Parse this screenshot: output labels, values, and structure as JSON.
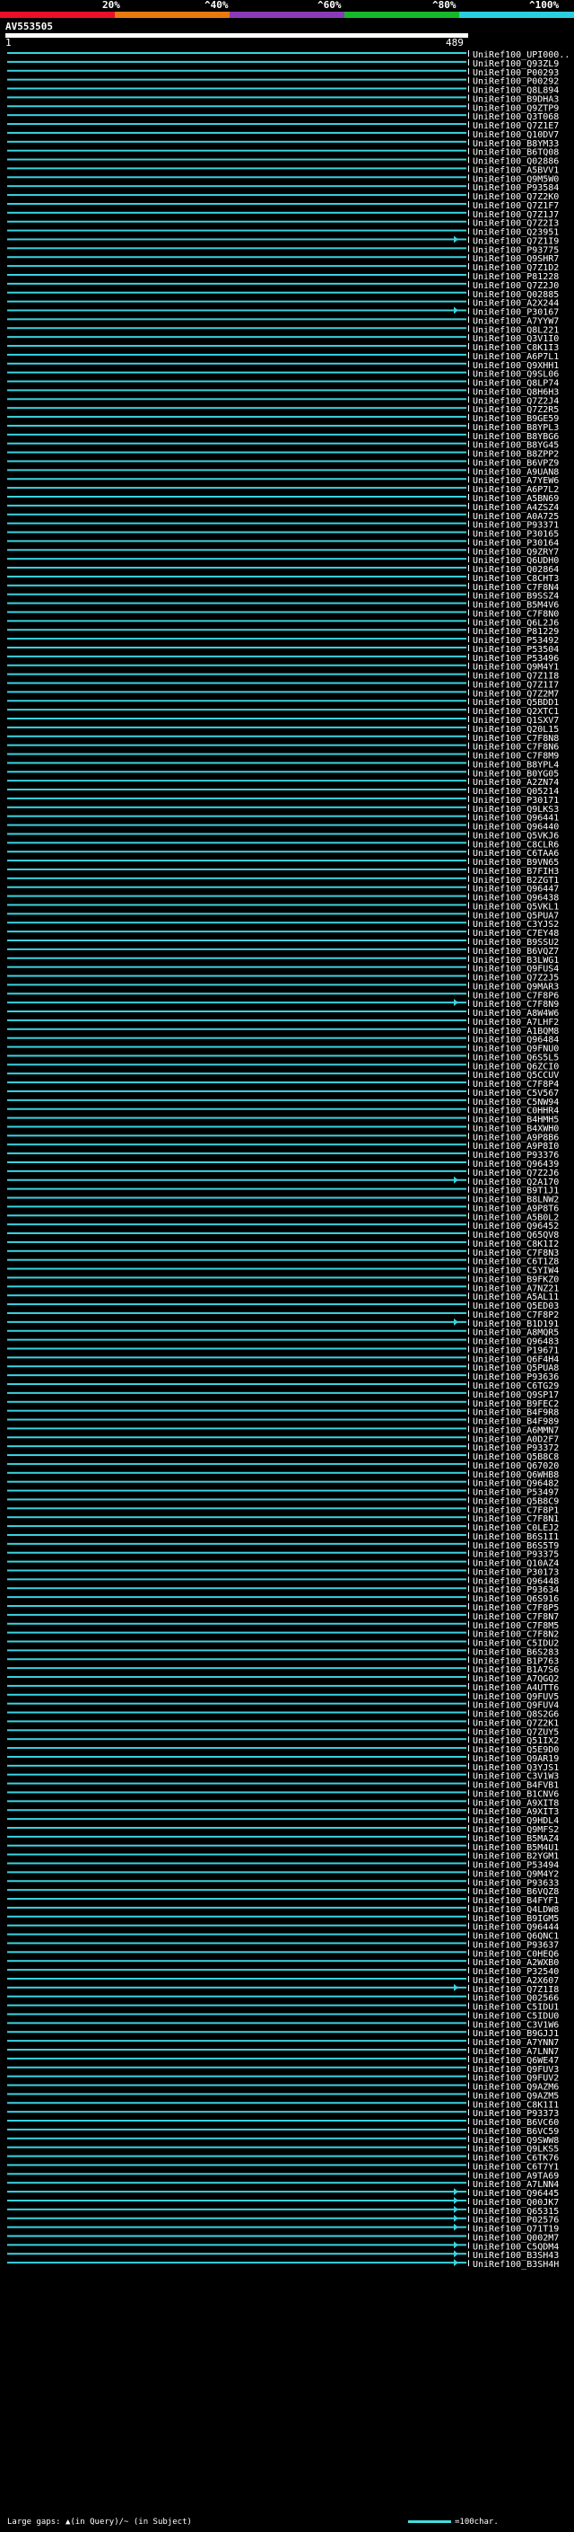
{
  "legend": {
    "labels": [
      "20%",
      "^40%",
      "^60%",
      "^80%",
      "^100%"
    ],
    "colors": [
      "#e8102a",
      "#e87a10",
      "#8a3ab8",
      "#16b82a",
      "#2ad0e0"
    ]
  },
  "query": {
    "title": "AV553505",
    "start": "1",
    "end": "489"
  },
  "footer": {
    "text": "Large gaps: ▲(in Query)/~ (in Subject)",
    "scale": "=100char."
  },
  "colors": {
    "hit": "#3ad4e0",
    "background": "#000000",
    "text": "#ffffff"
  },
  "chart_data": {
    "type": "alignment-overview",
    "query_length": 489,
    "hits": [
      {
        "id": "UniRef100_UPI000..",
        "gap_end": false
      },
      {
        "id": "UniRef100_Q93ZL9",
        "gap_end": false
      },
      {
        "id": "UniRef100_P00293",
        "gap_end": false
      },
      {
        "id": "UniRef100_P00292",
        "gap_end": false
      },
      {
        "id": "UniRef100_Q8L894",
        "gap_end": false
      },
      {
        "id": "UniRef100_B9DHA3",
        "gap_end": false
      },
      {
        "id": "UniRef100_Q9ZTP9",
        "gap_end": false
      },
      {
        "id": "UniRef100_Q3T068",
        "gap_end": false
      },
      {
        "id": "UniRef100_Q7Z1E7",
        "gap_end": false
      },
      {
        "id": "UniRef100_Q10DV7",
        "gap_end": false
      },
      {
        "id": "UniRef100_B8YM33",
        "gap_end": false
      },
      {
        "id": "UniRef100_B6TQ08",
        "gap_end": false
      },
      {
        "id": "UniRef100_Q02886",
        "gap_end": false
      },
      {
        "id": "UniRef100_A5BVV1",
        "gap_end": false
      },
      {
        "id": "UniRef100_Q9M5W0",
        "gap_end": false
      },
      {
        "id": "UniRef100_P93584",
        "gap_end": false
      },
      {
        "id": "UniRef100_Q7Z2K0",
        "gap_end": false
      },
      {
        "id": "UniRef100_Q7Z1F7",
        "gap_end": false
      },
      {
        "id": "UniRef100_Q7Z1J7",
        "gap_end": false
      },
      {
        "id": "UniRef100_Q7Z2I3",
        "gap_end": false
      },
      {
        "id": "UniRef100_Q23951",
        "gap_end": false
      },
      {
        "id": "UniRef100_Q7Z1I9",
        "gap_end": true
      },
      {
        "id": "UniRef100_P93775",
        "gap_end": false
      },
      {
        "id": "UniRef100_Q9SHR7",
        "gap_end": false
      },
      {
        "id": "UniRef100_Q7Z1D2",
        "gap_end": false
      },
      {
        "id": "UniRef100_P81228",
        "gap_end": false
      },
      {
        "id": "UniRef100_Q7Z2J0",
        "gap_end": false
      },
      {
        "id": "UniRef100_Q02885",
        "gap_end": false
      },
      {
        "id": "UniRef100_A2X244",
        "gap_end": false
      },
      {
        "id": "UniRef100_P30167",
        "gap_end": true
      },
      {
        "id": "UniRef100_A7YYW7",
        "gap_end": false
      },
      {
        "id": "UniRef100_Q8L221",
        "gap_end": false
      },
      {
        "id": "UniRef100_Q3V1I0",
        "gap_end": false
      },
      {
        "id": "UniRef100_C8K1I3",
        "gap_end": false
      },
      {
        "id": "UniRef100_A6P7L1",
        "gap_end": false
      },
      {
        "id": "UniRef100_Q9XHH1",
        "gap_end": false
      },
      {
        "id": "UniRef100_Q9SL06",
        "gap_end": false
      },
      {
        "id": "UniRef100_Q8LP74",
        "gap_end": false
      },
      {
        "id": "UniRef100_Q8H6H3",
        "gap_end": false
      },
      {
        "id": "UniRef100_Q7Z2J4",
        "gap_end": false
      },
      {
        "id": "UniRef100_Q7Z2R5",
        "gap_end": false
      },
      {
        "id": "UniRef100_B9GE59",
        "gap_end": false
      },
      {
        "id": "UniRef100_B8YPL3",
        "gap_end": false
      },
      {
        "id": "UniRef100_B8YBG6",
        "gap_end": false
      },
      {
        "id": "UniRef100_B8YG45",
        "gap_end": false
      },
      {
        "id": "UniRef100_B8ZPP2",
        "gap_end": false
      },
      {
        "id": "UniRef100_B6VPZ9",
        "gap_end": false
      },
      {
        "id": "UniRef100_A9UAN8",
        "gap_end": false
      },
      {
        "id": "UniRef100_A7YEW6",
        "gap_end": false
      },
      {
        "id": "UniRef100_A6P7L2",
        "gap_end": false
      },
      {
        "id": "UniRef100_A5BN69",
        "gap_end": false
      },
      {
        "id": "UniRef100_A4ZSZ4",
        "gap_end": false
      },
      {
        "id": "UniRef100_A0A725",
        "gap_end": false
      },
      {
        "id": "UniRef100_P93371",
        "gap_end": false
      },
      {
        "id": "UniRef100_P30165",
        "gap_end": false
      },
      {
        "id": "UniRef100_P30164",
        "gap_end": false
      },
      {
        "id": "UniRef100_Q9ZRY7",
        "gap_end": false
      },
      {
        "id": "UniRef100_Q6UDH0",
        "gap_end": false
      },
      {
        "id": "UniRef100_Q02864",
        "gap_end": false
      },
      {
        "id": "UniRef100_C8CHT3",
        "gap_end": false
      },
      {
        "id": "UniRef100_C7F8N4",
        "gap_end": false
      },
      {
        "id": "UniRef100_B9SSZ4",
        "gap_end": false
      },
      {
        "id": "UniRef100_B5M4V6",
        "gap_end": false
      },
      {
        "id": "UniRef100_C7F8N0",
        "gap_end": false
      },
      {
        "id": "UniRef100_Q6L2J6",
        "gap_end": false
      },
      {
        "id": "UniRef100_P81229",
        "gap_end": false
      },
      {
        "id": "UniRef100_P53492",
        "gap_end": false
      },
      {
        "id": "UniRef100_P53504",
        "gap_end": false
      },
      {
        "id": "UniRef100_P53496",
        "gap_end": false
      },
      {
        "id": "UniRef100_Q9M4Y1",
        "gap_end": false
      },
      {
        "id": "UniRef100_Q7Z1I8",
        "gap_end": false
      },
      {
        "id": "UniRef100_Q7Z1I7",
        "gap_end": false
      },
      {
        "id": "UniRef100_Q7Z2M7",
        "gap_end": false
      },
      {
        "id": "UniRef100_Q5BDD1",
        "gap_end": false
      },
      {
        "id": "UniRef100_Q2XTC1",
        "gap_end": false
      },
      {
        "id": "UniRef100_Q1SXV7",
        "gap_end": false
      },
      {
        "id": "UniRef100_Q20L15",
        "gap_end": false
      },
      {
        "id": "UniRef100_C7F8N8",
        "gap_end": false
      },
      {
        "id": "UniRef100_C7F8N6",
        "gap_end": false
      },
      {
        "id": "UniRef100_C7F8M9",
        "gap_end": false
      },
      {
        "id": "UniRef100_B8YPL4",
        "gap_end": false
      },
      {
        "id": "UniRef100_B0YG05",
        "gap_end": false
      },
      {
        "id": "UniRef100_A2ZN74",
        "gap_end": false
      },
      {
        "id": "UniRef100_Q05214",
        "gap_end": false
      },
      {
        "id": "UniRef100_P30171",
        "gap_end": false
      },
      {
        "id": "UniRef100_Q9LKS3",
        "gap_end": false
      },
      {
        "id": "UniRef100_Q96441",
        "gap_end": false
      },
      {
        "id": "UniRef100_Q96440",
        "gap_end": false
      },
      {
        "id": "UniRef100_Q5VKJ6",
        "gap_end": false
      },
      {
        "id": "UniRef100_C8CLR6",
        "gap_end": false
      },
      {
        "id": "UniRef100_C6TAA6",
        "gap_end": false
      },
      {
        "id": "UniRef100_B9VN65",
        "gap_end": false
      },
      {
        "id": "UniRef100_B7FIH3",
        "gap_end": false
      },
      {
        "id": "UniRef100_B2ZGT1",
        "gap_end": false
      },
      {
        "id": "UniRef100_Q96447",
        "gap_end": false
      },
      {
        "id": "UniRef100_Q96438",
        "gap_end": false
      },
      {
        "id": "UniRef100_Q5VKL1",
        "gap_end": false
      },
      {
        "id": "UniRef100_Q5PUA7",
        "gap_end": false
      },
      {
        "id": "UniRef100_C3YJS2",
        "gap_end": false
      },
      {
        "id": "UniRef100_C7EY48",
        "gap_end": false
      },
      {
        "id": "UniRef100_B9SSU2",
        "gap_end": false
      },
      {
        "id": "UniRef100_B6VQZ7",
        "gap_end": false
      },
      {
        "id": "UniRef100_B3LWG1",
        "gap_end": false
      },
      {
        "id": "UniRef100_Q9FUS4",
        "gap_end": false
      },
      {
        "id": "UniRef100_Q7Z2J5",
        "gap_end": false
      },
      {
        "id": "UniRef100_Q9MAR3",
        "gap_end": false
      },
      {
        "id": "UniRef100_C7F8P6",
        "gap_end": false
      },
      {
        "id": "UniRef100_C7F8N9",
        "gap_end": true
      },
      {
        "id": "UniRef100_A8W4W6",
        "gap_end": false
      },
      {
        "id": "UniRef100_A7LHF2",
        "gap_end": false
      },
      {
        "id": "UniRef100_A1BQM8",
        "gap_end": false
      },
      {
        "id": "UniRef100_Q96484",
        "gap_end": false
      },
      {
        "id": "UniRef100_Q9FNU0",
        "gap_end": false
      },
      {
        "id": "UniRef100_Q6S5L5",
        "gap_end": false
      },
      {
        "id": "UniRef100_Q6ZCI0",
        "gap_end": false
      },
      {
        "id": "UniRef100_Q5CCUV",
        "gap_end": false
      },
      {
        "id": "UniRef100_C7F8P4",
        "gap_end": false
      },
      {
        "id": "UniRef100_C5V567",
        "gap_end": false
      },
      {
        "id": "UniRef100_C5NW94",
        "gap_end": false
      },
      {
        "id": "UniRef100_C0HHR4",
        "gap_end": false
      },
      {
        "id": "UniRef100_B4HMH5",
        "gap_end": false
      },
      {
        "id": "UniRef100_B4XWH0",
        "gap_end": false
      },
      {
        "id": "UniRef100_A9P8B6",
        "gap_end": false
      },
      {
        "id": "UniRef100_A9P8I0",
        "gap_end": false
      },
      {
        "id": "UniRef100_P93376",
        "gap_end": false
      },
      {
        "id": "UniRef100_Q96439",
        "gap_end": false
      },
      {
        "id": "UniRef100_Q7Z2J6",
        "gap_end": false
      },
      {
        "id": "UniRef100_Q2A170",
        "gap_end": true
      },
      {
        "id": "UniRef100_B9T1J1",
        "gap_end": false
      },
      {
        "id": "UniRef100_B8LNW2",
        "gap_end": false
      },
      {
        "id": "UniRef100_A9P8T6",
        "gap_end": false
      },
      {
        "id": "UniRef100_A5B0L2",
        "gap_end": false
      },
      {
        "id": "UniRef100_Q96452",
        "gap_end": false
      },
      {
        "id": "UniRef100_Q65QV8",
        "gap_end": false
      },
      {
        "id": "UniRef100_C8K1I2",
        "gap_end": false
      },
      {
        "id": "UniRef100_C7F8N3",
        "gap_end": false
      },
      {
        "id": "UniRef100_C6T1Z8",
        "gap_end": false
      },
      {
        "id": "UniRef100_C5YIW4",
        "gap_end": false
      },
      {
        "id": "UniRef100_B9FKZ0",
        "gap_end": false
      },
      {
        "id": "UniRef100_A7NZ21",
        "gap_end": false
      },
      {
        "id": "UniRef100_A5AL11",
        "gap_end": false
      },
      {
        "id": "UniRef100_Q5ED03",
        "gap_end": false
      },
      {
        "id": "UniRef100_C7F8P2",
        "gap_end": false
      },
      {
        "id": "UniRef100_B1D191",
        "gap_end": true
      },
      {
        "id": "UniRef100_A8MQR5",
        "gap_end": false
      },
      {
        "id": "UniRef100_Q96483",
        "gap_end": false
      },
      {
        "id": "UniRef100_P19671",
        "gap_end": false
      },
      {
        "id": "UniRef100_Q6F4H4",
        "gap_end": false
      },
      {
        "id": "UniRef100_Q5PUA8",
        "gap_end": false
      },
      {
        "id": "UniRef100_P93636",
        "gap_end": false
      },
      {
        "id": "UniRef100_C6TG29",
        "gap_end": false
      },
      {
        "id": "UniRef100_Q9SP17",
        "gap_end": false
      },
      {
        "id": "UniRef100_B9FEC2",
        "gap_end": false
      },
      {
        "id": "UniRef100_B4F9R8",
        "gap_end": false
      },
      {
        "id": "UniRef100_B4F989",
        "gap_end": false
      },
      {
        "id": "UniRef100_A6MMN7",
        "gap_end": false
      },
      {
        "id": "UniRef100_A0D2F7",
        "gap_end": false
      },
      {
        "id": "UniRef100_P93372",
        "gap_end": false
      },
      {
        "id": "UniRef100_Q5B8C8",
        "gap_end": false
      },
      {
        "id": "UniRef100_Q67020",
        "gap_end": false
      },
      {
        "id": "UniRef100_Q6WHB8",
        "gap_end": false
      },
      {
        "id": "UniRef100_Q96482",
        "gap_end": false
      },
      {
        "id": "UniRef100_P53497",
        "gap_end": false
      },
      {
        "id": "UniRef100_Q5B8C9",
        "gap_end": false
      },
      {
        "id": "UniRef100_C7F8P1",
        "gap_end": false
      },
      {
        "id": "UniRef100_C7F8N1",
        "gap_end": false
      },
      {
        "id": "UniRef100_C0LEJ2",
        "gap_end": false
      },
      {
        "id": "UniRef100_B6S1I1",
        "gap_end": false
      },
      {
        "id": "UniRef100_B6S5T9",
        "gap_end": false
      },
      {
        "id": "UniRef100_P93375",
        "gap_end": false
      },
      {
        "id": "UniRef100_Q10AZ4",
        "gap_end": false
      },
      {
        "id": "UniRef100_P30173",
        "gap_end": false
      },
      {
        "id": "UniRef100_Q96448",
        "gap_end": false
      },
      {
        "id": "UniRef100_P93634",
        "gap_end": false
      },
      {
        "id": "UniRef100_Q6S916",
        "gap_end": false
      },
      {
        "id": "UniRef100_C7F8P5",
        "gap_end": false
      },
      {
        "id": "UniRef100_C7F8N7",
        "gap_end": false
      },
      {
        "id": "UniRef100_C7F8M5",
        "gap_end": false
      },
      {
        "id": "UniRef100_C7F8N2",
        "gap_end": false
      },
      {
        "id": "UniRef100_C5IDU2",
        "gap_end": false
      },
      {
        "id": "UniRef100_B6S283",
        "gap_end": false
      },
      {
        "id": "UniRef100_B1P763",
        "gap_end": false
      },
      {
        "id": "UniRef100_B1A7S6",
        "gap_end": false
      },
      {
        "id": "UniRef100_A7QGQ2",
        "gap_end": false
      },
      {
        "id": "UniRef100_A4UTT6",
        "gap_end": false
      },
      {
        "id": "UniRef100_Q9FUV5",
        "gap_end": false
      },
      {
        "id": "UniRef100_Q9FUV4",
        "gap_end": false
      },
      {
        "id": "UniRef100_Q8S2G6",
        "gap_end": false
      },
      {
        "id": "UniRef100_Q7Z2K1",
        "gap_end": false
      },
      {
        "id": "UniRef100_Q7ZUY5",
        "gap_end": false
      },
      {
        "id": "UniRef100_Q51IX2",
        "gap_end": false
      },
      {
        "id": "UniRef100_Q5E9D0",
        "gap_end": false
      },
      {
        "id": "UniRef100_Q9AR19",
        "gap_end": false
      },
      {
        "id": "UniRef100_Q3YJS1",
        "gap_end": false
      },
      {
        "id": "UniRef100_C3V1W3",
        "gap_end": false
      },
      {
        "id": "UniRef100_B4FVB1",
        "gap_end": false
      },
      {
        "id": "UniRef100_B1CNV6",
        "gap_end": false
      },
      {
        "id": "UniRef100_A9XIT8",
        "gap_end": false
      },
      {
        "id": "UniRef100_A9XIT3",
        "gap_end": false
      },
      {
        "id": "UniRef100_Q9HDL4",
        "gap_end": false
      },
      {
        "id": "UniRef100_Q9MFS2",
        "gap_end": false
      },
      {
        "id": "UniRef100_B5MAZ4",
        "gap_end": false
      },
      {
        "id": "UniRef100_B5M4U1",
        "gap_end": false
      },
      {
        "id": "UniRef100_B2YGM1",
        "gap_end": false
      },
      {
        "id": "UniRef100_P53494",
        "gap_end": false
      },
      {
        "id": "UniRef100_Q9M4Y2",
        "gap_end": false
      },
      {
        "id": "UniRef100_P93633",
        "gap_end": false
      },
      {
        "id": "UniRef100_B6VQZ8",
        "gap_end": false
      },
      {
        "id": "UniRef100_B4FYF1",
        "gap_end": false
      },
      {
        "id": "UniRef100_Q4LDW8",
        "gap_end": false
      },
      {
        "id": "UniRef100_B9IGM5",
        "gap_end": false
      },
      {
        "id": "UniRef100_Q96444",
        "gap_end": false
      },
      {
        "id": "UniRef100_Q6QNC1",
        "gap_end": false
      },
      {
        "id": "UniRef100_P93637",
        "gap_end": false
      },
      {
        "id": "UniRef100_C0HEQ6",
        "gap_end": false
      },
      {
        "id": "UniRef100_A2WXB0",
        "gap_end": false
      },
      {
        "id": "UniRef100_P32540",
        "gap_end": false
      },
      {
        "id": "UniRef100_A2X607",
        "gap_end": false
      },
      {
        "id": "UniRef100_Q7Z1I8",
        "gap_end": true
      },
      {
        "id": "UniRef100_Q02566",
        "gap_end": false
      },
      {
        "id": "UniRef100_C5IDU1",
        "gap_end": false
      },
      {
        "id": "UniRef100_C5IDU0",
        "gap_end": false
      },
      {
        "id": "UniRef100_C3V1W6",
        "gap_end": false
      },
      {
        "id": "UniRef100_B9GJJ1",
        "gap_end": false
      },
      {
        "id": "UniRef100_A7YNN7",
        "gap_end": false
      },
      {
        "id": "UniRef100_A7LNN7",
        "gap_end": false
      },
      {
        "id": "UniRef100_Q6WE47",
        "gap_end": false
      },
      {
        "id": "UniRef100_Q9FUV3",
        "gap_end": false
      },
      {
        "id": "UniRef100_Q9FUV2",
        "gap_end": false
      },
      {
        "id": "UniRef100_Q9AZM6",
        "gap_end": false
      },
      {
        "id": "UniRef100_Q9AZM5",
        "gap_end": false
      },
      {
        "id": "UniRef100_C8K1I1",
        "gap_end": false
      },
      {
        "id": "UniRef100_P93373",
        "gap_end": false
      },
      {
        "id": "UniRef100_B6VC60",
        "gap_end": false
      },
      {
        "id": "UniRef100_B6VC59",
        "gap_end": false
      },
      {
        "id": "UniRef100_Q9SWW8",
        "gap_end": false
      },
      {
        "id": "UniRef100_Q9LKS5",
        "gap_end": false
      },
      {
        "id": "UniRef100_C6TK76",
        "gap_end": false
      },
      {
        "id": "UniRef100_C6T7Y1",
        "gap_end": false
      },
      {
        "id": "UniRef100_A9TA69",
        "gap_end": false
      },
      {
        "id": "UniRef100_A7LNN4",
        "gap_end": false
      },
      {
        "id": "UniRef100_Q96445",
        "gap_end": true
      },
      {
        "id": "UniRef100_Q00JK7",
        "gap_end": true
      },
      {
        "id": "UniRef100_Q65315",
        "gap_end": true
      },
      {
        "id": "UniRef100_P02576",
        "gap_end": true
      },
      {
        "id": "UniRef100_Q71T19",
        "gap_end": true
      },
      {
        "id": "UniRef100_Q002M7",
        "gap_end": false
      },
      {
        "id": "UniRef100_C5QDM4",
        "gap_end": true
      },
      {
        "id": "UniRef100_B3SH43",
        "gap_end": true
      },
      {
        "id": "UniRef100_B3SH4H",
        "gap_end": true
      }
    ]
  }
}
